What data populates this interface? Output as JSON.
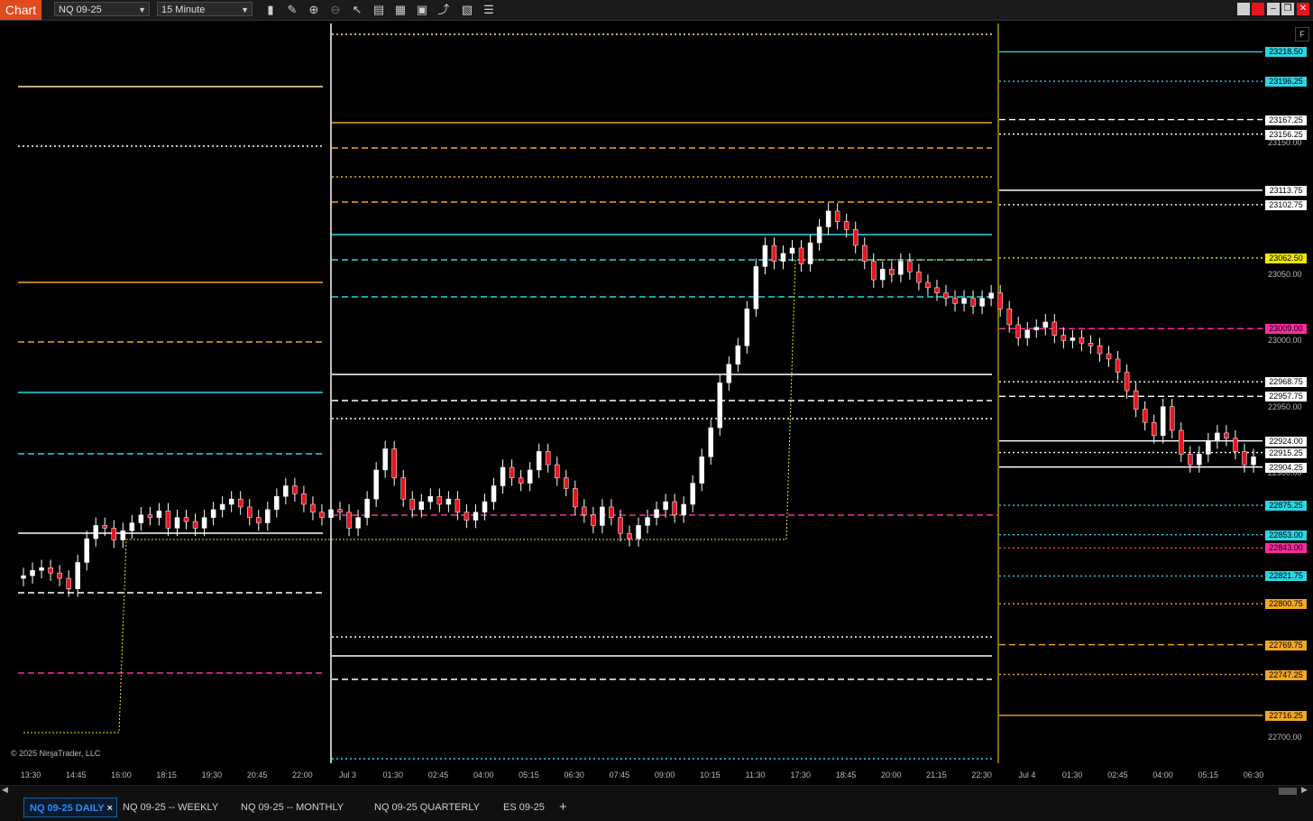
{
  "toolbar": {
    "chart_tab": "Chart",
    "instrument": "NQ 09-25",
    "interval": "15 Minute",
    "tools": [
      "bar-type-icon",
      "pencil-icon",
      "zoom-in-icon",
      "zoom-out-icon",
      "pointer-icon",
      "data-box-icon",
      "templates-icon",
      "properties-icon",
      "indicators-icon",
      "strategies-icon",
      "menu-icon"
    ]
  },
  "copyright": "© 2025 NinjaTrader, LLC",
  "axis_button": "F",
  "price_labels": [
    {
      "text": "23218.50",
      "color": "#27d7e6"
    },
    {
      "text": "23196.25",
      "color": "#27d7e6"
    },
    {
      "text": "23167.25",
      "color": "#ffffff"
    },
    {
      "text": "23156.25",
      "color": "#ffffff"
    },
    {
      "text": "23113.75",
      "color": "#ffffff"
    },
    {
      "text": "23102.75",
      "color": "#ffffff"
    },
    {
      "text": "23062.50",
      "color": "#f2e600"
    },
    {
      "text": "23009.00",
      "color": "#ff2aa0"
    },
    {
      "text": "22968.75",
      "color": "#ffffff"
    },
    {
      "text": "22957.75",
      "color": "#ffffff"
    },
    {
      "text": "22924.00",
      "color": "#ffffff"
    },
    {
      "text": "22915.25",
      "color": "#ffffff"
    },
    {
      "text": "22904.25",
      "color": "#ffffff"
    },
    {
      "text": "22875.25",
      "color": "#27d7e6"
    },
    {
      "text": "22853.00",
      "color": "#27d7e6"
    },
    {
      "text": "22843.00",
      "color": "#ff2aa0"
    },
    {
      "text": "22821.75",
      "color": "#27d7e6"
    },
    {
      "text": "22800.75",
      "color": "#f5a623"
    },
    {
      "text": "22769.75",
      "color": "#f5a623"
    },
    {
      "text": "22747.25",
      "color": "#f5a623"
    },
    {
      "text": "22716.25",
      "color": "#f5a623"
    }
  ],
  "price_ticks": [
    "23150.00",
    "23050.00",
    "23000.00",
    "22950.00",
    "22900.00",
    "22700.00"
  ],
  "time_labels": [
    "13:30",
    "14:45",
    "16:00",
    "18:15",
    "19:30",
    "20:45",
    "22:00",
    "Jul 3",
    "01:30",
    "02:45",
    "04:00",
    "05:15",
    "06:30",
    "07:45",
    "09:00",
    "10:15",
    "11:30",
    "17:30",
    "18:45",
    "20:00",
    "21:15",
    "22:30",
    "Jul 4",
    "01:30",
    "02:45",
    "04:00",
    "05:15",
    "06:30"
  ],
  "tabs": [
    {
      "label": "NQ 09-25 DAILY",
      "active": true,
      "close": "×"
    },
    {
      "label": "NQ 09-25 -- WEEKLY"
    },
    {
      "label": "NQ 09-25 -- MONTHLY"
    },
    {
      "label": "NQ 09-25 QUARTERLY"
    },
    {
      "label": "ES 09-25"
    }
  ],
  "add_tab": "+",
  "colors": {
    "up": "#ffffff",
    "down": "#e8141e",
    "cyan": "#27d7e6",
    "orange": "#f5a623",
    "magenta": "#ff2aa0",
    "yellow": "#f2e600",
    "accent": "#e04a1f"
  },
  "chart_data": {
    "type": "candlestick",
    "instrument": "NQ 09-25",
    "interval": "15 Minute",
    "y_axis": {
      "min": 22680,
      "max": 23240
    },
    "session_dividers": [
      "Jul 3",
      "Jul 4"
    ],
    "closes": [
      22822,
      22826,
      22828,
      22824,
      22820,
      22812,
      22832,
      22850,
      22860,
      22858,
      22849,
      22856,
      22862,
      22868,
      22866,
      22871,
      22858,
      22866,
      22863,
      22858,
      22866,
      22872,
      22876,
      22880,
      22874,
      22866,
      22862,
      22872,
      22882,
      22890,
      22884,
      22876,
      22870,
      22866,
      22872,
      22870,
      22858,
      22866,
      22880,
      22902,
      22918,
      22896,
      22880,
      22872,
      22878,
      22882,
      22876,
      22880,
      22870,
      22864,
      22870,
      22878,
      22890,
      22904,
      22896,
      22892,
      22902,
      22916,
      22906,
      22896,
      22888,
      22874,
      22868,
      22860,
      22874,
      22866,
      22854,
      22850,
      22860,
      22866,
      22872,
      22878,
      22868,
      22876,
      22892,
      22912,
      22934,
      22968,
      22982,
      22996,
      23024,
      23056,
      23072,
      23060,
      23066,
      23070,
      23058,
      23074,
      23086,
      23098,
      23090,
      23084,
      23072,
      23060,
      23046,
      23054,
      23050,
      23060,
      23052,
      23044,
      23040,
      23036,
      23032,
      23028,
      23032,
      23026,
      23032,
      23036,
      23024,
      23012,
      23002,
      23008,
      23010,
      23014,
      23004,
      23000,
      23002,
      22998,
      22996,
      22990,
      22986,
      22976,
      22962,
      22948,
      22938,
      22928,
      22950,
      22932,
      22914,
      22906,
      22914,
      22924,
      22930,
      22926,
      22916,
      22906,
      22912
    ]
  }
}
